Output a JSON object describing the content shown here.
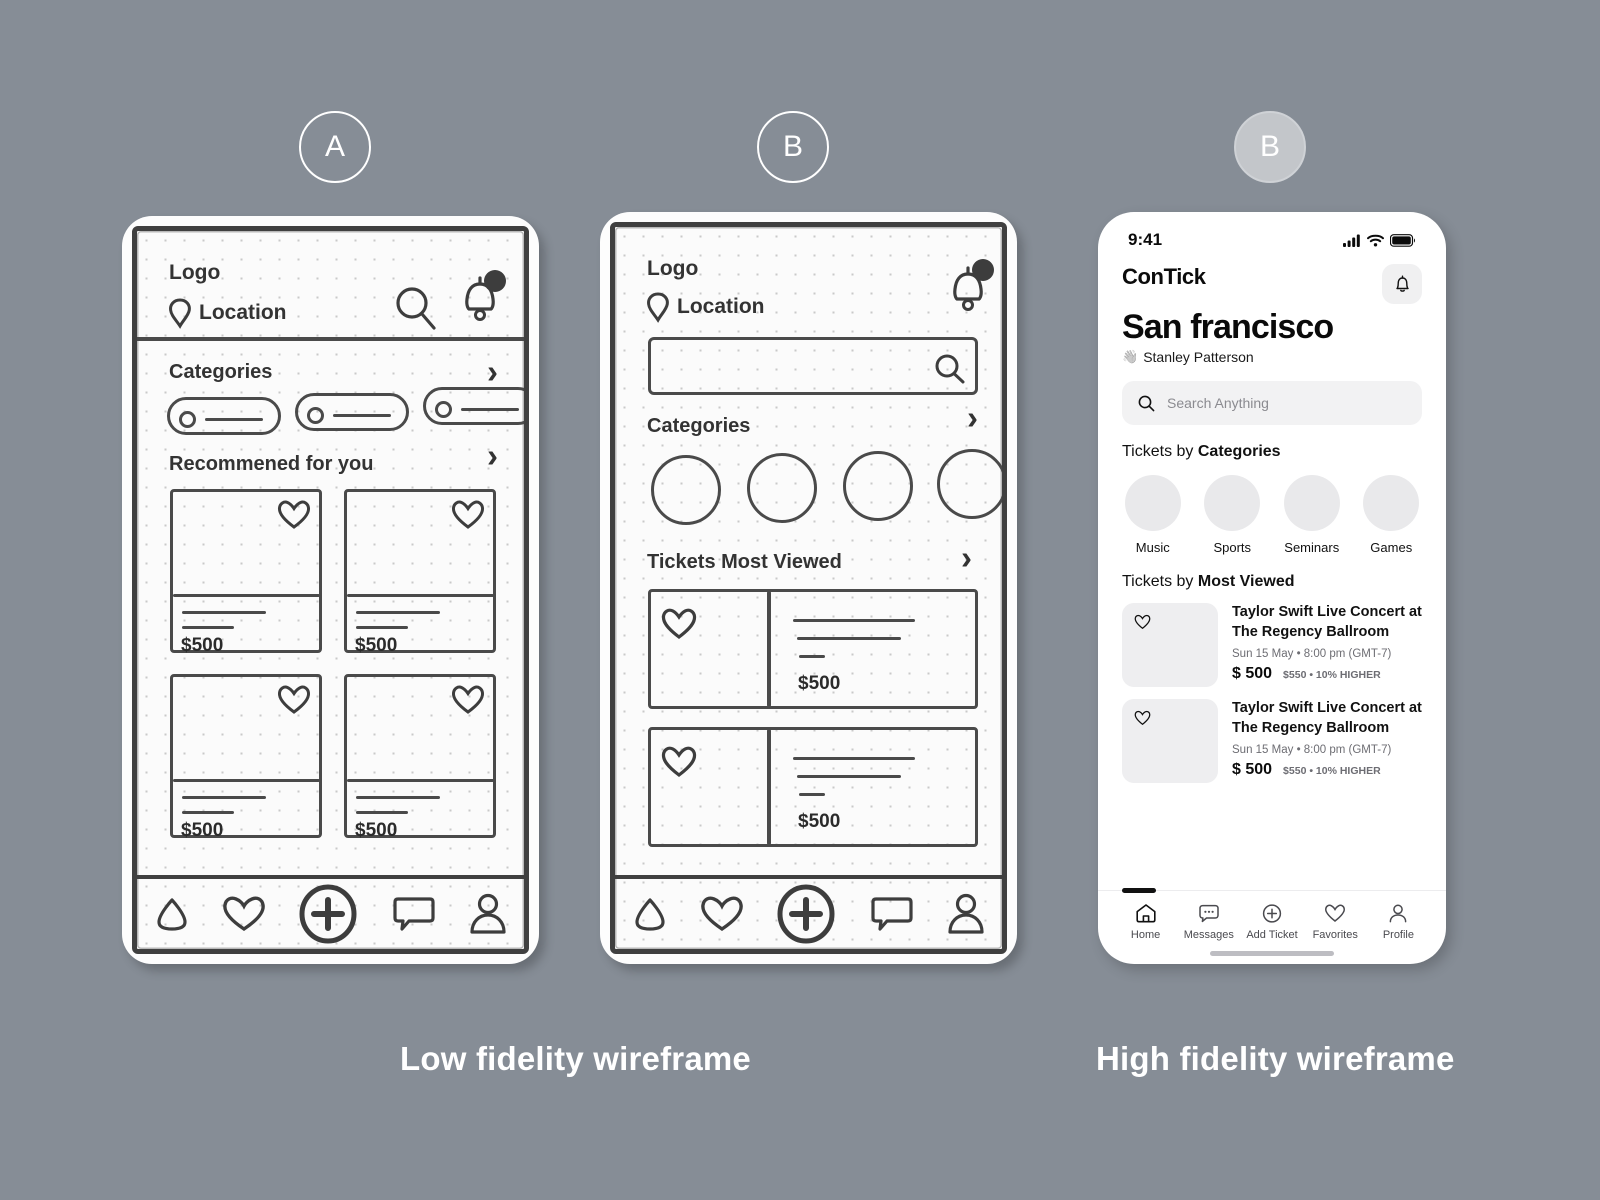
{
  "canvas": {
    "background": "#868d96"
  },
  "badges": [
    {
      "label": "A",
      "style": "outline"
    },
    {
      "label": "B",
      "style": "outline"
    },
    {
      "label": "B",
      "style": "filled"
    }
  ],
  "captions": {
    "low": "Low fidelity wireframe",
    "high": "High fidelity wireframe"
  },
  "wireframe_a": {
    "logo": "Logo",
    "location": "Location",
    "search_icon": "search-icon",
    "bell_icon": "bell-icon",
    "categories_title": "Categories",
    "recommended_title": "Recommened for you",
    "chevron": "›",
    "cards": [
      {
        "price": "$500"
      },
      {
        "price": "$500"
      },
      {
        "price": "$500"
      },
      {
        "price": "$500"
      }
    ],
    "nav": [
      "home-icon",
      "heart-icon",
      "plus-icon",
      "chat-icon",
      "person-icon"
    ]
  },
  "wireframe_b": {
    "logo": "Logo",
    "location": "Location",
    "bell_icon": "bell-icon",
    "search_icon": "search-icon",
    "categories_title": "Categories",
    "category_circles": 4,
    "most_viewed_title": "Tickets Most Viewed",
    "chevron": "›",
    "rows": [
      {
        "price": "$500"
      },
      {
        "price": "$500"
      }
    ],
    "nav": [
      "home-icon",
      "heart-icon",
      "plus-icon",
      "chat-icon",
      "person-icon"
    ]
  },
  "hifi": {
    "status": {
      "time": "9:41",
      "signal": "signal-icon",
      "wifi": "wifi-icon",
      "battery": "battery-icon"
    },
    "brand": "ConTick",
    "bell_icon": "bell-icon",
    "city": "San francisco",
    "greeting_emoji": "👋",
    "greeting_name": "Stanley Patterson",
    "search": {
      "placeholder": "Search Anything",
      "icon": "search-icon"
    },
    "categories_section": {
      "prefix": "Tickets by ",
      "strong": "Categories"
    },
    "categories": [
      {
        "label": "Music"
      },
      {
        "label": "Sports"
      },
      {
        "label": "Seminars"
      },
      {
        "label": "Games"
      }
    ],
    "most_viewed_section": {
      "prefix": "Tickets by ",
      "strong": "Most Viewed"
    },
    "tickets": [
      {
        "title": "Taylor Swift Live Concert at The Regency Ballroom",
        "meta": "Sun 15 May  •  8:00 pm (GMT-7)",
        "price": "$ 500",
        "compare": "$550 • 10% HIGHER",
        "favorite_icon": "heart-icon"
      },
      {
        "title": "Taylor Swift Live Concert at The Regency Ballroom",
        "meta": "Sun 15 May  •  8:00 pm (GMT-7)",
        "price": "$ 500",
        "compare": "$550 • 10% HIGHER",
        "favorite_icon": "heart-icon"
      }
    ],
    "nav": [
      {
        "label": "Home",
        "icon": "home-icon"
      },
      {
        "label": "Messages",
        "icon": "message-icon"
      },
      {
        "label": "Add Ticket",
        "icon": "plus-circle-icon"
      },
      {
        "label": "Favorites",
        "icon": "heart-icon"
      },
      {
        "label": "Profile",
        "icon": "person-icon"
      }
    ]
  }
}
